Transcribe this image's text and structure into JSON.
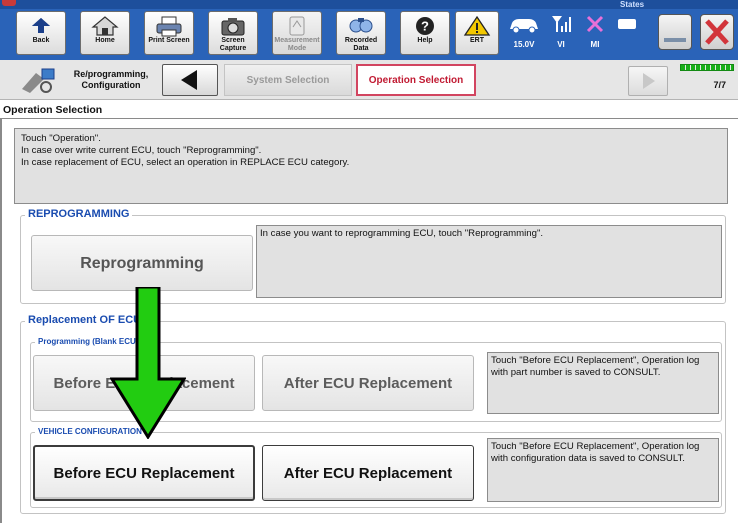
{
  "toolbar": {
    "states_label": "States",
    "buttons": [
      {
        "label": "Back",
        "icon": "back-arrow-icon"
      },
      {
        "label": "Home",
        "icon": "home-icon"
      },
      {
        "label": "Print Screen",
        "icon": "printer-icon"
      },
      {
        "label": "Screen Capture",
        "icon": "camera-icon"
      },
      {
        "label": "Measurement Mode",
        "icon": "measurement-icon"
      },
      {
        "label": "Recorded Data",
        "icon": "recorded-data-icon"
      },
      {
        "label": "Help",
        "icon": "help-icon"
      },
      {
        "label": "ERT",
        "icon": "warning-icon"
      }
    ],
    "status": {
      "voltage": "15.0V",
      "vi": "VI",
      "mi": "MI"
    }
  },
  "nav": {
    "title": "Re/programming, Configuration",
    "crumb_system": "System Selection",
    "crumb_operation": "Operation Selection",
    "page": "7/7"
  },
  "section_title": "Operation Selection",
  "instruction": {
    "line1": "Touch \"Operation\".",
    "line2": "In case over write current ECU, touch \"Reprogramming\".",
    "line3": "In case replacement of ECU, select an operation in REPLACE ECU category."
  },
  "reprogramming": {
    "legend": "REPROGRAMMING",
    "button": "Reprogramming",
    "desc": "In case you want to reprogramming ECU, touch \"Reprogramming\"."
  },
  "replacement": {
    "legend": "Replacement OF ECU",
    "programming": {
      "legend": "Programming (Blank ECU)",
      "before": "Before ECU Replacement",
      "after": "After ECU Replacement",
      "desc": "Touch \"Before ECU Replacement\", Operation log with part number is saved to CONSULT."
    },
    "vehicle_config": {
      "legend": "VEHICLE CONFIGURATION",
      "before": "Before ECU Replacement",
      "after": "After ECU Replacement",
      "desc": "Touch \"Before ECU Replacement\", Operation log with configuration data is saved to CONSULT."
    }
  },
  "colors": {
    "toolbar": "#2a63b8",
    "active_crumb": "#c11a32",
    "legend": "#1a4cb0",
    "arrow": "#22cc11"
  }
}
